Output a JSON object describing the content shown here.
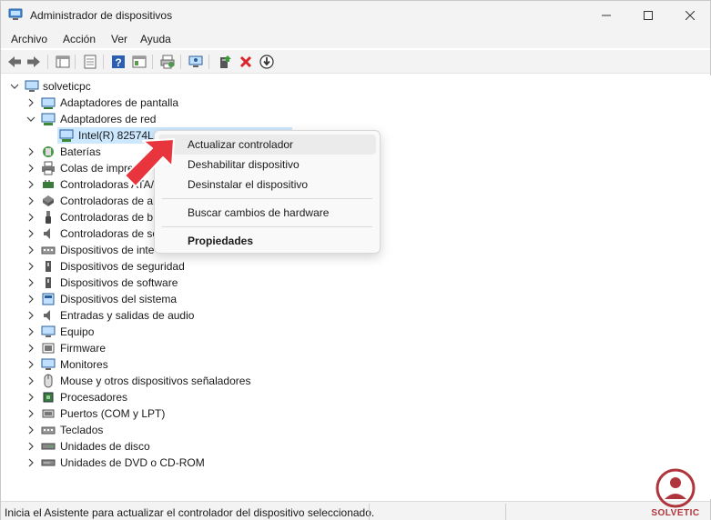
{
  "window": {
    "title": "Administrador de dispositivos"
  },
  "menu": [
    "Archivo",
    "Acción",
    "Ver",
    "Ayuda"
  ],
  "tree": {
    "root": "solveticpc",
    "categories": [
      {
        "label": "Adaptadores de pantalla",
        "icon": "display-adapter-icon",
        "expanded": false
      },
      {
        "label": "Adaptadores de red",
        "icon": "network-adapter-icon",
        "expanded": true,
        "children": [
          {
            "label": "Intel(R) 82574L Gigabit Network Connection",
            "visible_label": "Intel(R) 82574L G",
            "icon": "network-adapter-icon",
            "selected": true
          }
        ]
      },
      {
        "label": "Baterías",
        "icon": "battery-icon",
        "expanded": false
      },
      {
        "label": "Colas de impresión",
        "visible_label": "Colas de impres",
        "icon": "printer-icon",
        "expanded": false
      },
      {
        "label": "Controladoras ATA/ATAPI IDE",
        "visible_label": "Controladoras ATA/",
        "icon": "ide-controller-icon",
        "expanded": false
      },
      {
        "label": "Controladoras de almacenamiento",
        "visible_label": "Controladoras de al",
        "icon": "storage-controller-icon",
        "expanded": false
      },
      {
        "label": "Controladoras de bus serie universal",
        "visible_label": "Controladoras de b",
        "icon": "usb-controller-icon",
        "expanded": false
      },
      {
        "label": "Controladoras de sonido y vídeo y dispositivos de juego",
        "visible_label": "Controladoras de so",
        "icon": "sound-controller-icon",
        "expanded": false
      },
      {
        "label": "Dispositivos de interfaz de usuario (HID)",
        "visible_label": "Dispositivos de inte",
        "icon": "hid-icon",
        "expanded": false
      },
      {
        "label": "Dispositivos de seguridad",
        "icon": "security-device-icon",
        "expanded": false
      },
      {
        "label": "Dispositivos de software",
        "icon": "software-device-icon",
        "expanded": false
      },
      {
        "label": "Dispositivos del sistema",
        "icon": "system-device-icon",
        "expanded": false
      },
      {
        "label": "Entradas y salidas de audio",
        "icon": "audio-icon",
        "expanded": false
      },
      {
        "label": "Equipo",
        "icon": "computer-icon",
        "expanded": false
      },
      {
        "label": "Firmware",
        "icon": "firmware-icon",
        "expanded": false
      },
      {
        "label": "Monitores",
        "icon": "monitor-icon",
        "expanded": false
      },
      {
        "label": "Mouse y otros dispositivos señaladores",
        "icon": "mouse-icon",
        "expanded": false
      },
      {
        "label": "Procesadores",
        "icon": "processor-icon",
        "expanded": false
      },
      {
        "label": "Puertos (COM y LPT)",
        "icon": "port-icon",
        "expanded": false
      },
      {
        "label": "Teclados",
        "icon": "keyboard-icon",
        "expanded": false
      },
      {
        "label": "Unidades de disco",
        "icon": "disk-drive-icon",
        "expanded": false
      },
      {
        "label": "Unidades de DVD o CD-ROM",
        "icon": "dvd-drive-icon",
        "expanded": false
      }
    ]
  },
  "context_menu": {
    "items": [
      "Actualizar controlador",
      "Deshabilitar dispositivo",
      "Desinstalar el dispositivo",
      "Buscar cambios de hardware",
      "Propiedades"
    ],
    "hovered": "Actualizar controlador"
  },
  "status": {
    "text": "Inicia el Asistente para actualizar el controlador del dispositivo seleccionado."
  },
  "watermark": {
    "text": "SOLVETIC"
  },
  "colors": {
    "selection": "#cce8ff",
    "accent": "#0067c0",
    "arrow": "#e8343c",
    "delete": "#d9262a"
  }
}
